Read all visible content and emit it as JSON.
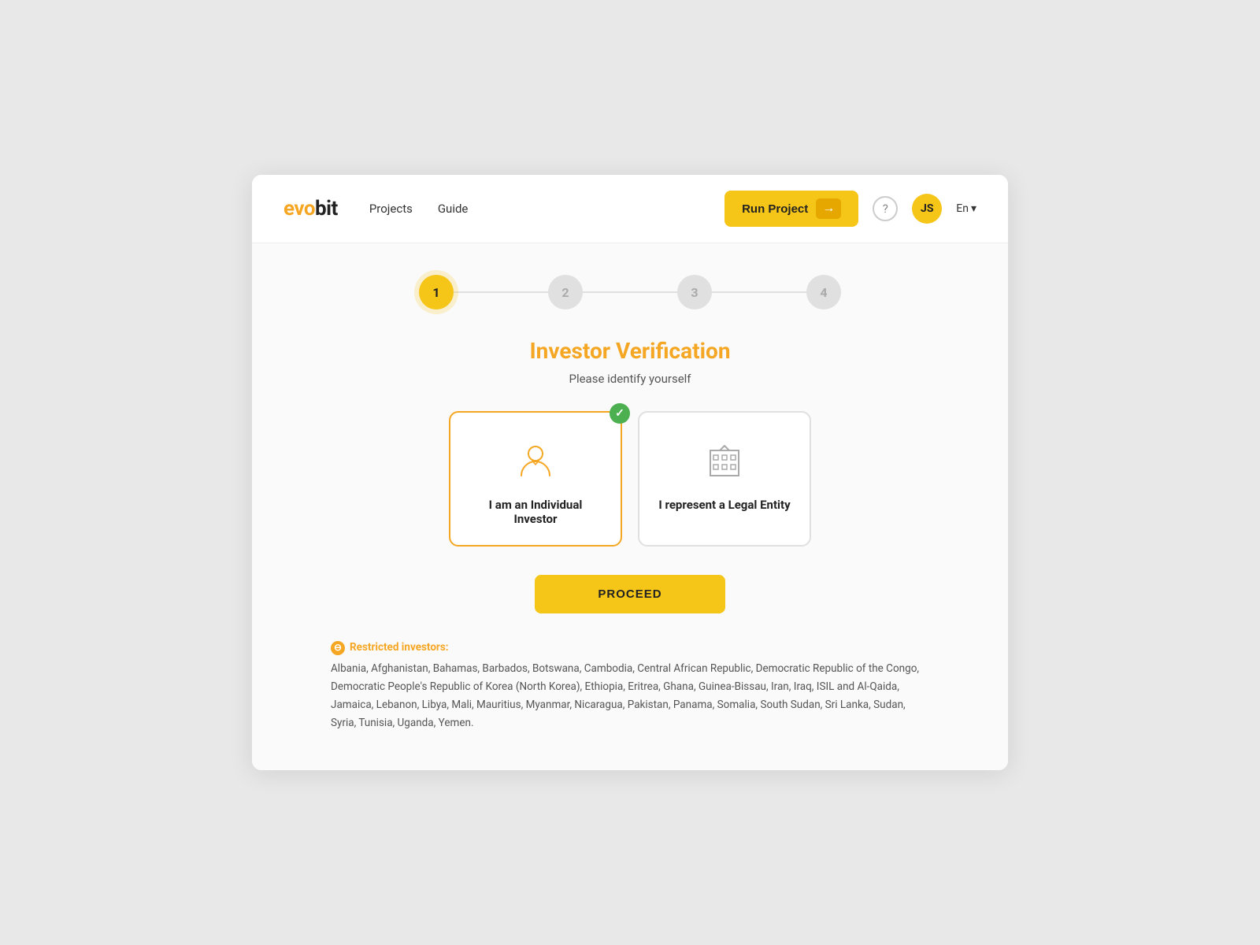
{
  "logo": {
    "evo": "evo",
    "bit": "bit"
  },
  "nav": {
    "projects": "Projects",
    "guide": "Guide"
  },
  "header": {
    "run_project": "Run Project",
    "lang": "En",
    "avatar_initials": "JS"
  },
  "steps": {
    "list": [
      {
        "number": "1",
        "active": true
      },
      {
        "number": "2",
        "active": false
      },
      {
        "number": "3",
        "active": false
      },
      {
        "number": "4",
        "active": false
      }
    ]
  },
  "page": {
    "title": "Investor Verification",
    "subtitle": "Please identify yourself"
  },
  "choices": [
    {
      "id": "individual",
      "label": "I am an Individual Investor",
      "selected": true
    },
    {
      "id": "entity",
      "label": "I represent a Legal Entity",
      "selected": false
    }
  ],
  "proceed_button": "PROCEED",
  "restricted": {
    "title": "Restricted investors:",
    "text": "Albania, Afghanistan, Bahamas, Barbados, Botswana, Cambodia, Central African Republic, Democratic Republic of the Congo, Democratic People's Republic of Korea (North Korea), Ethiopia, Eritrea, Ghana, Guinea-Bissau, Iran, Iraq, ISIL and Al-Qaida, Jamaica, Lebanon, Libya, Mali, Mauritius, Myanmar, Nicaragua, Pakistan, Panama, Somalia, South Sudan, Sri Lanka, Sudan, Syria, Tunisia, Uganda, Yemen."
  }
}
